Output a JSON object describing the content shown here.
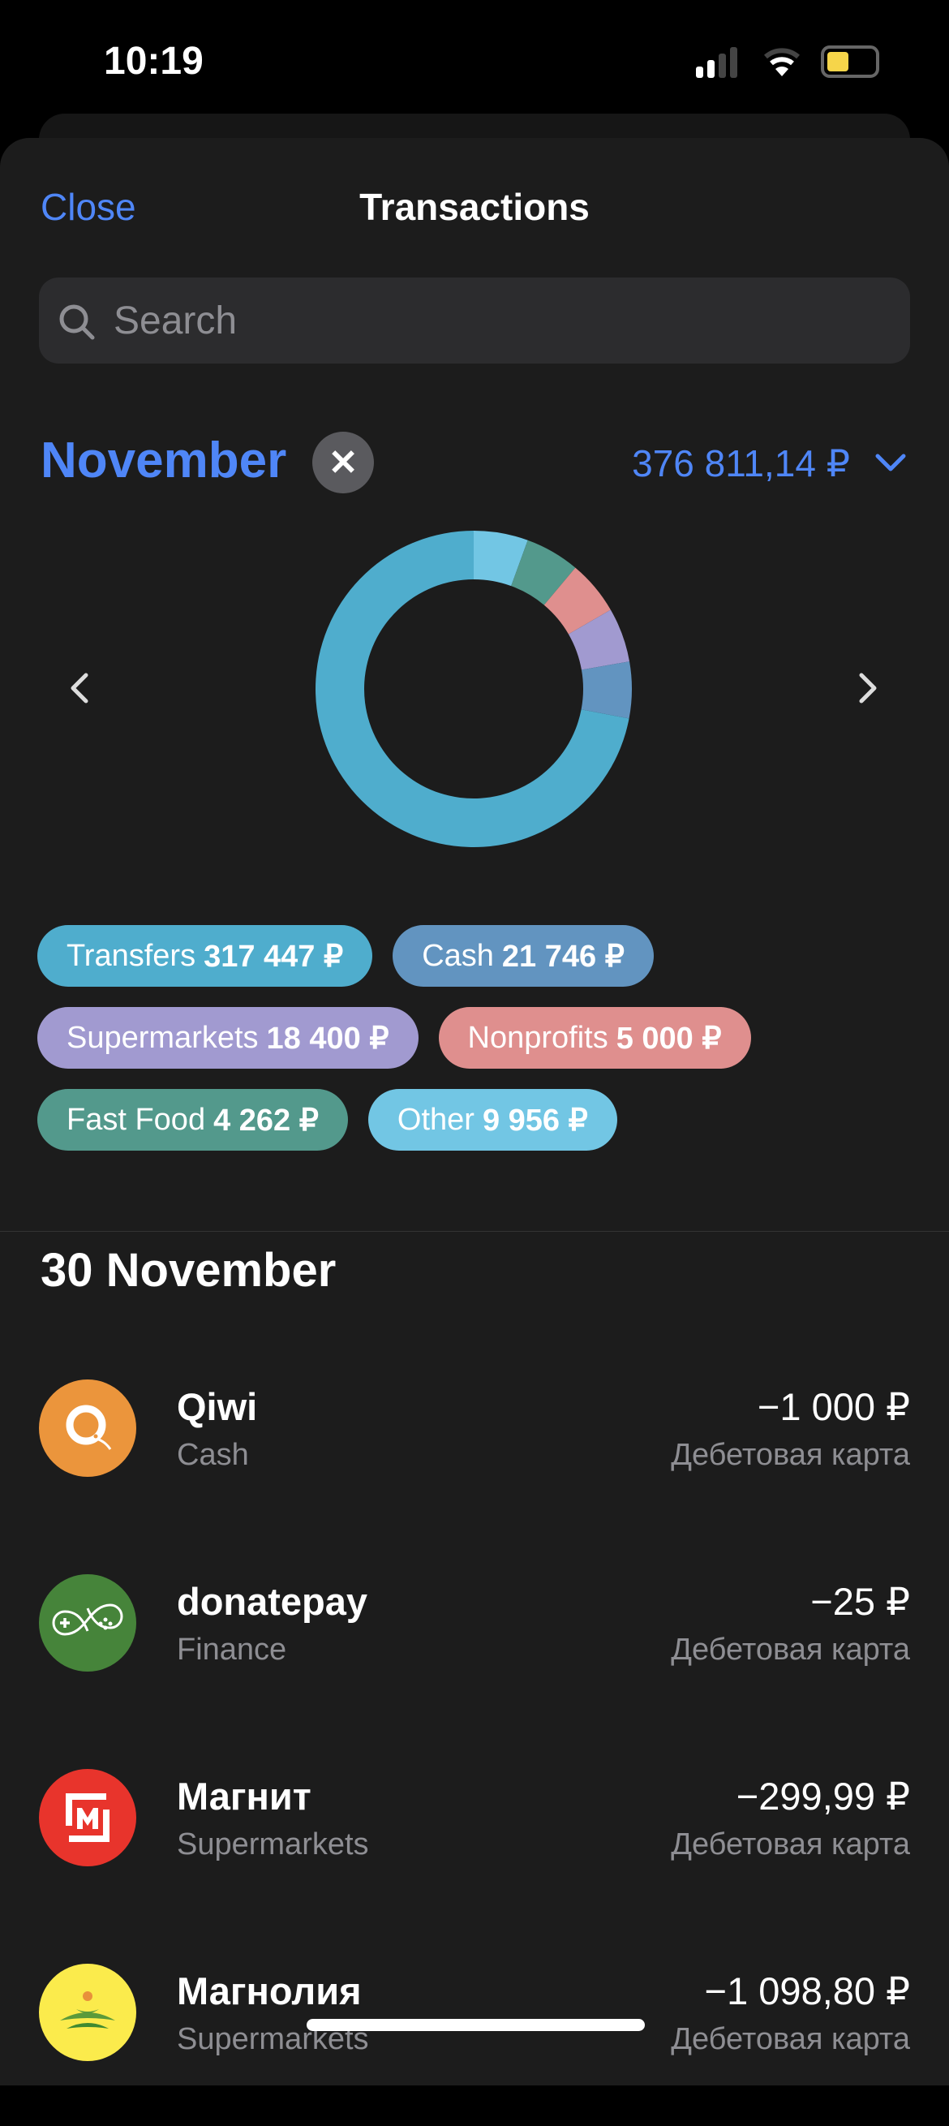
{
  "status": {
    "time": "10:19"
  },
  "header": {
    "close": "Close",
    "title": "Transactions"
  },
  "search": {
    "placeholder": "Search"
  },
  "period": {
    "month": "November",
    "total": "376 811,14 ₽"
  },
  "chart_data": {
    "type": "pie",
    "subtype": "donut",
    "categories": [
      "Other",
      "Fast Food",
      "Nonprofits",
      "Supermarkets",
      "Cash",
      "Transfers"
    ],
    "values": [
      9956,
      4262,
      5000,
      18400,
      21746,
      317447
    ],
    "colors": [
      "#72c6e4",
      "#53998c",
      "#df8f8e",
      "#a19ad0",
      "#6294c0",
      "#4fadcd"
    ],
    "unit": "₽"
  },
  "chips": [
    [
      {
        "label": "Transfers",
        "value": "317 447 ₽",
        "color": "#4fadcd"
      },
      {
        "label": "Cash",
        "value": "21 746 ₽",
        "color": "#6294c0"
      }
    ],
    [
      {
        "label": "Supermarkets",
        "value": "18 400 ₽",
        "color": "#a19ad0"
      },
      {
        "label": "Nonprofits",
        "value": "5 000 ₽",
        "color": "#df8f8e"
      }
    ],
    [
      {
        "label": "Fast Food",
        "value": "4 262 ₽",
        "color": "#53998c"
      },
      {
        "label": "Other",
        "value": "9 956 ₽",
        "color": "#72c6e4"
      }
    ]
  ],
  "section": {
    "date": "30 November"
  },
  "transactions": [
    {
      "name": "Qiwi",
      "category": "Cash",
      "amount": "−1 000 ₽",
      "account": "Дебетовая карта",
      "icon": "qiwi-logo-icon",
      "color": "#eb953c"
    },
    {
      "name": "donatepay",
      "category": "Finance",
      "amount": "−25 ₽",
      "account": "Дебетовая карта",
      "icon": "gamepad-icon",
      "color": "#46843a"
    },
    {
      "name": "Магнит",
      "category": "Supermarkets",
      "amount": "−299,99 ₽",
      "account": "Дебетовая карта",
      "icon": "magnit-logo-icon",
      "color": "#e8342c"
    },
    {
      "name": "Магнолия",
      "category": "Supermarkets",
      "amount": "−1 098,80 ₽",
      "account": "Дебетовая карта",
      "icon": "magnolia-logo-icon",
      "color": "#fbeb4c"
    }
  ]
}
